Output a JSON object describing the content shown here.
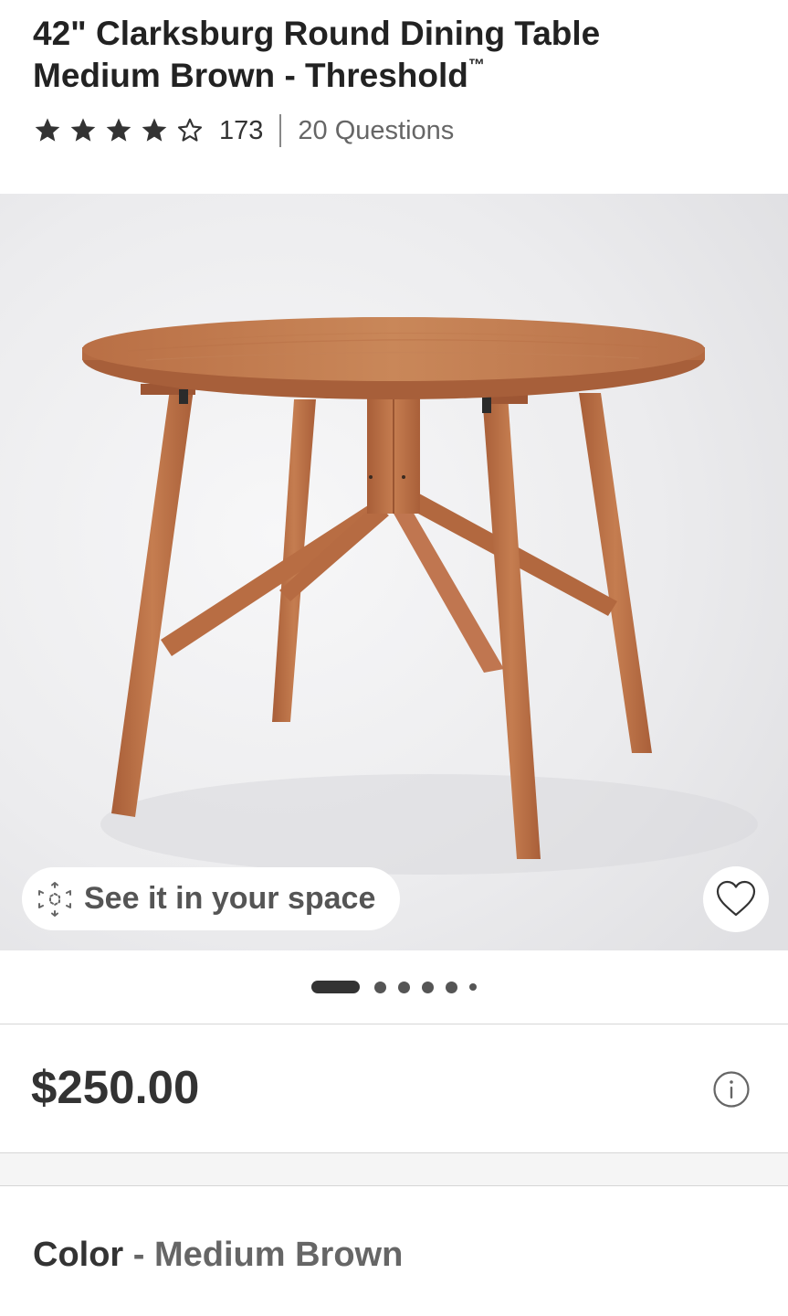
{
  "product": {
    "title_line1": "42\" Clarksburg Round Dining Table",
    "title_line2": "Medium Brown - Threshold",
    "title_mark": "™",
    "rating": 4,
    "rating_max": 5,
    "review_count": "173",
    "questions_label": "20 Questions"
  },
  "gallery": {
    "ar_button_label": "See it in your space",
    "ar_icon": "ar-cube-icon",
    "favorite_icon": "heart-outline-icon",
    "image_count": 6,
    "active_index": 0
  },
  "pricing": {
    "price": "$250.00",
    "info_icon": "info-icon"
  },
  "variant": {
    "color_label": "Color",
    "separator": "-",
    "color_value": "Medium Brown"
  },
  "colors": {
    "text_primary": "#333333",
    "text_secondary": "#666666",
    "star": "#333333",
    "wood": "#c27a4e",
    "gallery_background": "#ebebed"
  }
}
